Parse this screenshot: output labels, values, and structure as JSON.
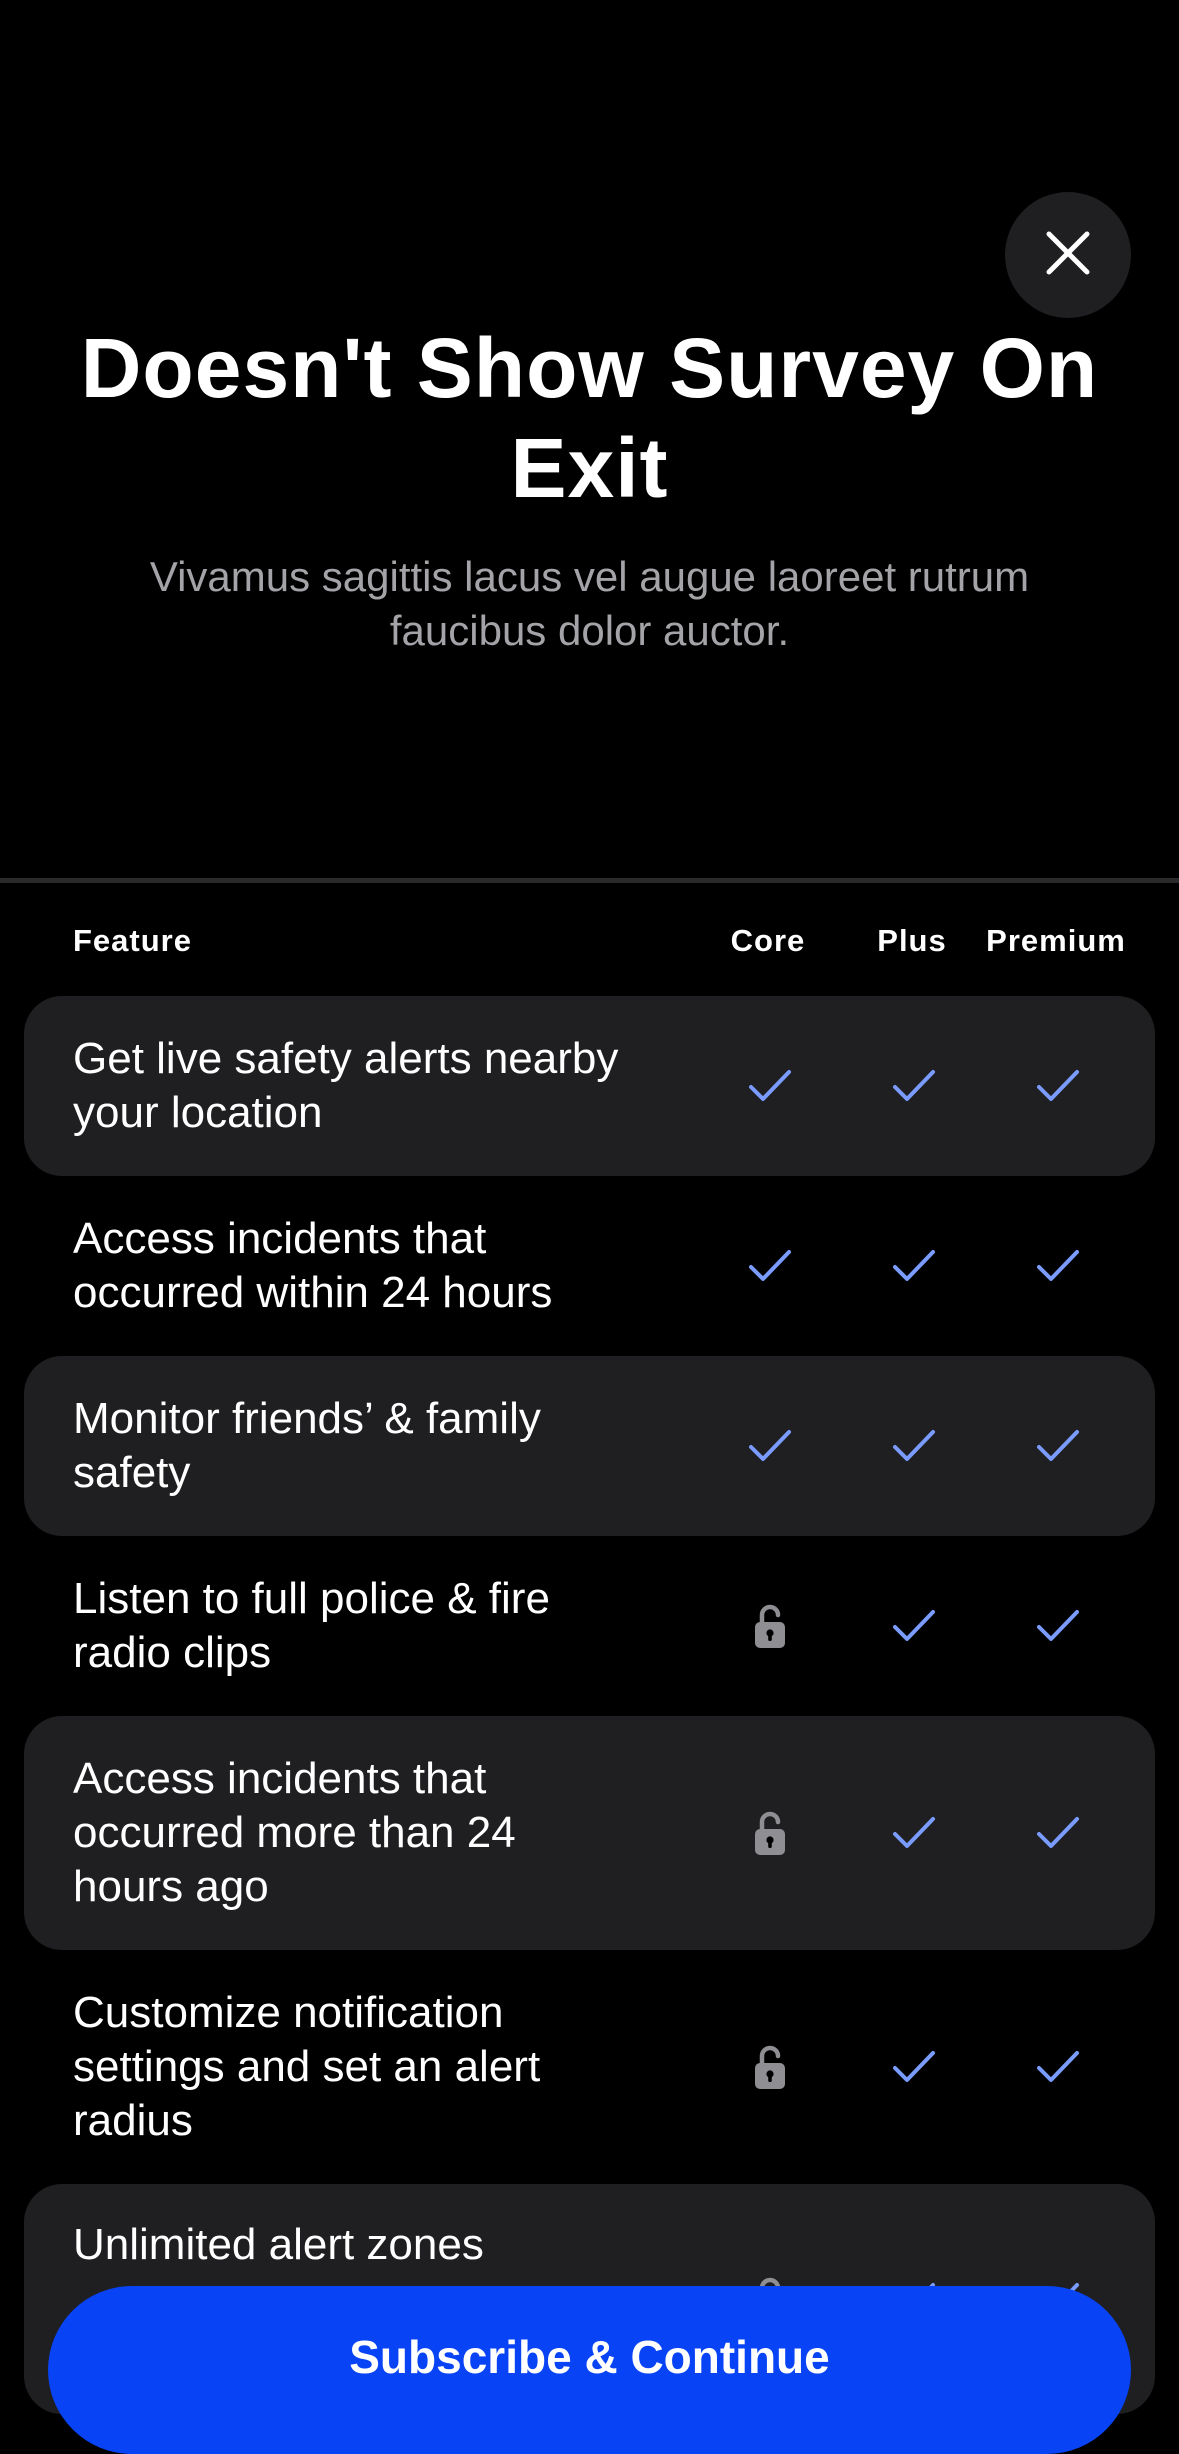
{
  "close_icon": "close-icon",
  "title": "Doesn't Show Survey On Exit",
  "subtitle": "Vivamus sagittis lacus vel augue laoreet rutrum faucibus dolor auctor.",
  "table": {
    "headers": {
      "feature": "Feature",
      "core": "Core",
      "plus": "Plus",
      "premium": "Premium"
    },
    "rows": [
      {
        "label": "Get live safety alerts nearby your location",
        "core": "check",
        "plus": "check",
        "premium": "check"
      },
      {
        "label": "Access incidents that occurred within 24 hours",
        "core": "check",
        "plus": "check",
        "premium": "check"
      },
      {
        "label": "Monitor friends’ & family safety",
        "core": "check",
        "plus": "check",
        "premium": "check"
      },
      {
        "label": "Listen to full police & fire radio clips",
        "core": "lock",
        "plus": "check",
        "premium": "check"
      },
      {
        "label": "Access incidents that occurred more than 24 hours ago",
        "core": "lock",
        "plus": "check",
        "premium": "check"
      },
      {
        "label": "Customize notification settings and set an alert radius",
        "core": "lock",
        "plus": "check",
        "premium": "check"
      },
      {
        "label": "Unlimited alert zones",
        "core": "lock",
        "plus": "check",
        "premium": "check"
      }
    ]
  },
  "cta_label": "Subscribe & Continue",
  "colors": {
    "background": "#000000",
    "accent": "#0844F5",
    "check": "#7A9CFF",
    "lock": "#8E8E93",
    "row_shade": "#1F1F21"
  }
}
